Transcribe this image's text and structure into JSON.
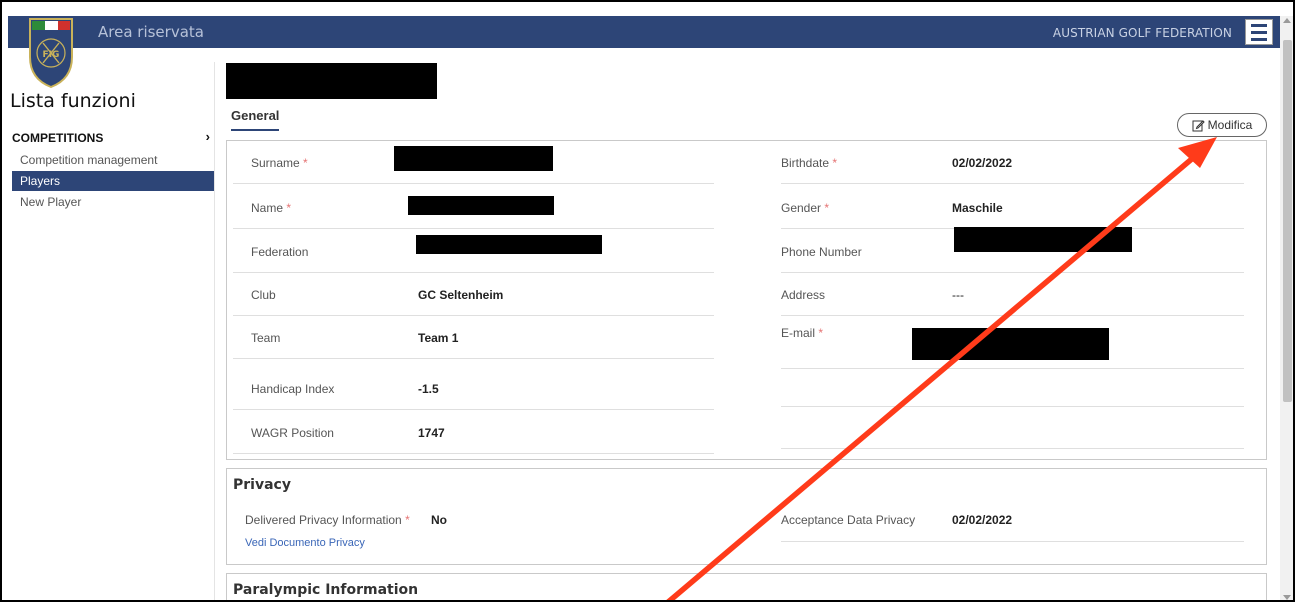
{
  "header": {
    "title": "Area riservata",
    "organization": "AUSTRIAN GOLF FEDERATION",
    "logo_text": "FIG"
  },
  "sidebar": {
    "title": "Lista funzioni",
    "section": "COMPETITIONS",
    "items": [
      {
        "label": "Competition management"
      },
      {
        "label": "Players",
        "active": true
      },
      {
        "label": "New Player"
      }
    ]
  },
  "tabs": {
    "general": "General"
  },
  "actions": {
    "modifica": "Modifica"
  },
  "required_mark": "*",
  "general": {
    "left": [
      {
        "label": "Surname",
        "required": true,
        "value": ""
      },
      {
        "label": "Name",
        "required": true,
        "value": ""
      },
      {
        "label": "Federation",
        "value": ""
      },
      {
        "label": "Club",
        "value": "GC Seltenheim"
      },
      {
        "label": "Team",
        "value": "Team 1"
      },
      {
        "label": "Handicap Index",
        "value": "-1.5"
      },
      {
        "label": "WAGR Position",
        "value": "1747"
      }
    ],
    "right": [
      {
        "label": "Birthdate",
        "required": true,
        "value": "02/02/2022"
      },
      {
        "label": "Gender",
        "required": true,
        "value": "Maschile"
      },
      {
        "label": "Phone Number",
        "value": ""
      },
      {
        "label": "Address",
        "value": "---"
      },
      {
        "label": "E-mail",
        "required": true,
        "value": ""
      }
    ]
  },
  "privacy": {
    "title": "Privacy",
    "delivered_label": "Delivered Privacy Information",
    "delivered_value": "No",
    "link": "Vedi Documento Privacy",
    "acceptance_label": "Acceptance Data Privacy",
    "acceptance_value": "02/02/2022"
  },
  "paralympic": {
    "title": "Paralympic Information"
  },
  "colors": {
    "navbar": "#2d4577",
    "annotation_arrow": "#ff3b1a",
    "link": "#3a66b7"
  }
}
